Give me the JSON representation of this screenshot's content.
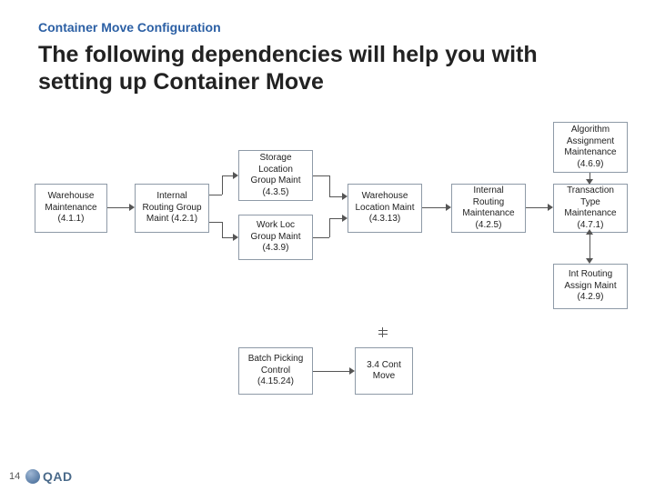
{
  "header": {
    "small": "Container Move Configuration",
    "big": "The following dependencies will help you with setting up Container Move"
  },
  "boxes": {
    "warehouse_maint": "Warehouse Maintenance (4.1.1)",
    "int_routing_group": "Internal Routing Group Maint (4.2.1)",
    "storage_loc_group": "Storage Location Group Maint (4.3.5)",
    "work_loc_group": "Work Loc Group Maint (4.3.9)",
    "warehouse_loc_maint": "Warehouse Location Maint (4.3.13)",
    "int_routing_maint": "Internal Routing Maintenance (4.2.5)",
    "algo_assign_maint": "Algorithm Assignment Maintenance (4.6.9)",
    "trans_type_maint": "Transaction Type Maintenance (4.7.1)",
    "int_routing_assign": "Int Routing Assign Maint (4.2.9)",
    "batch_picking": "Batch Picking Control (4.15.24)",
    "cont_move": "3.4 Cont Move"
  },
  "footer": {
    "page": "14",
    "logo": "QAD"
  }
}
